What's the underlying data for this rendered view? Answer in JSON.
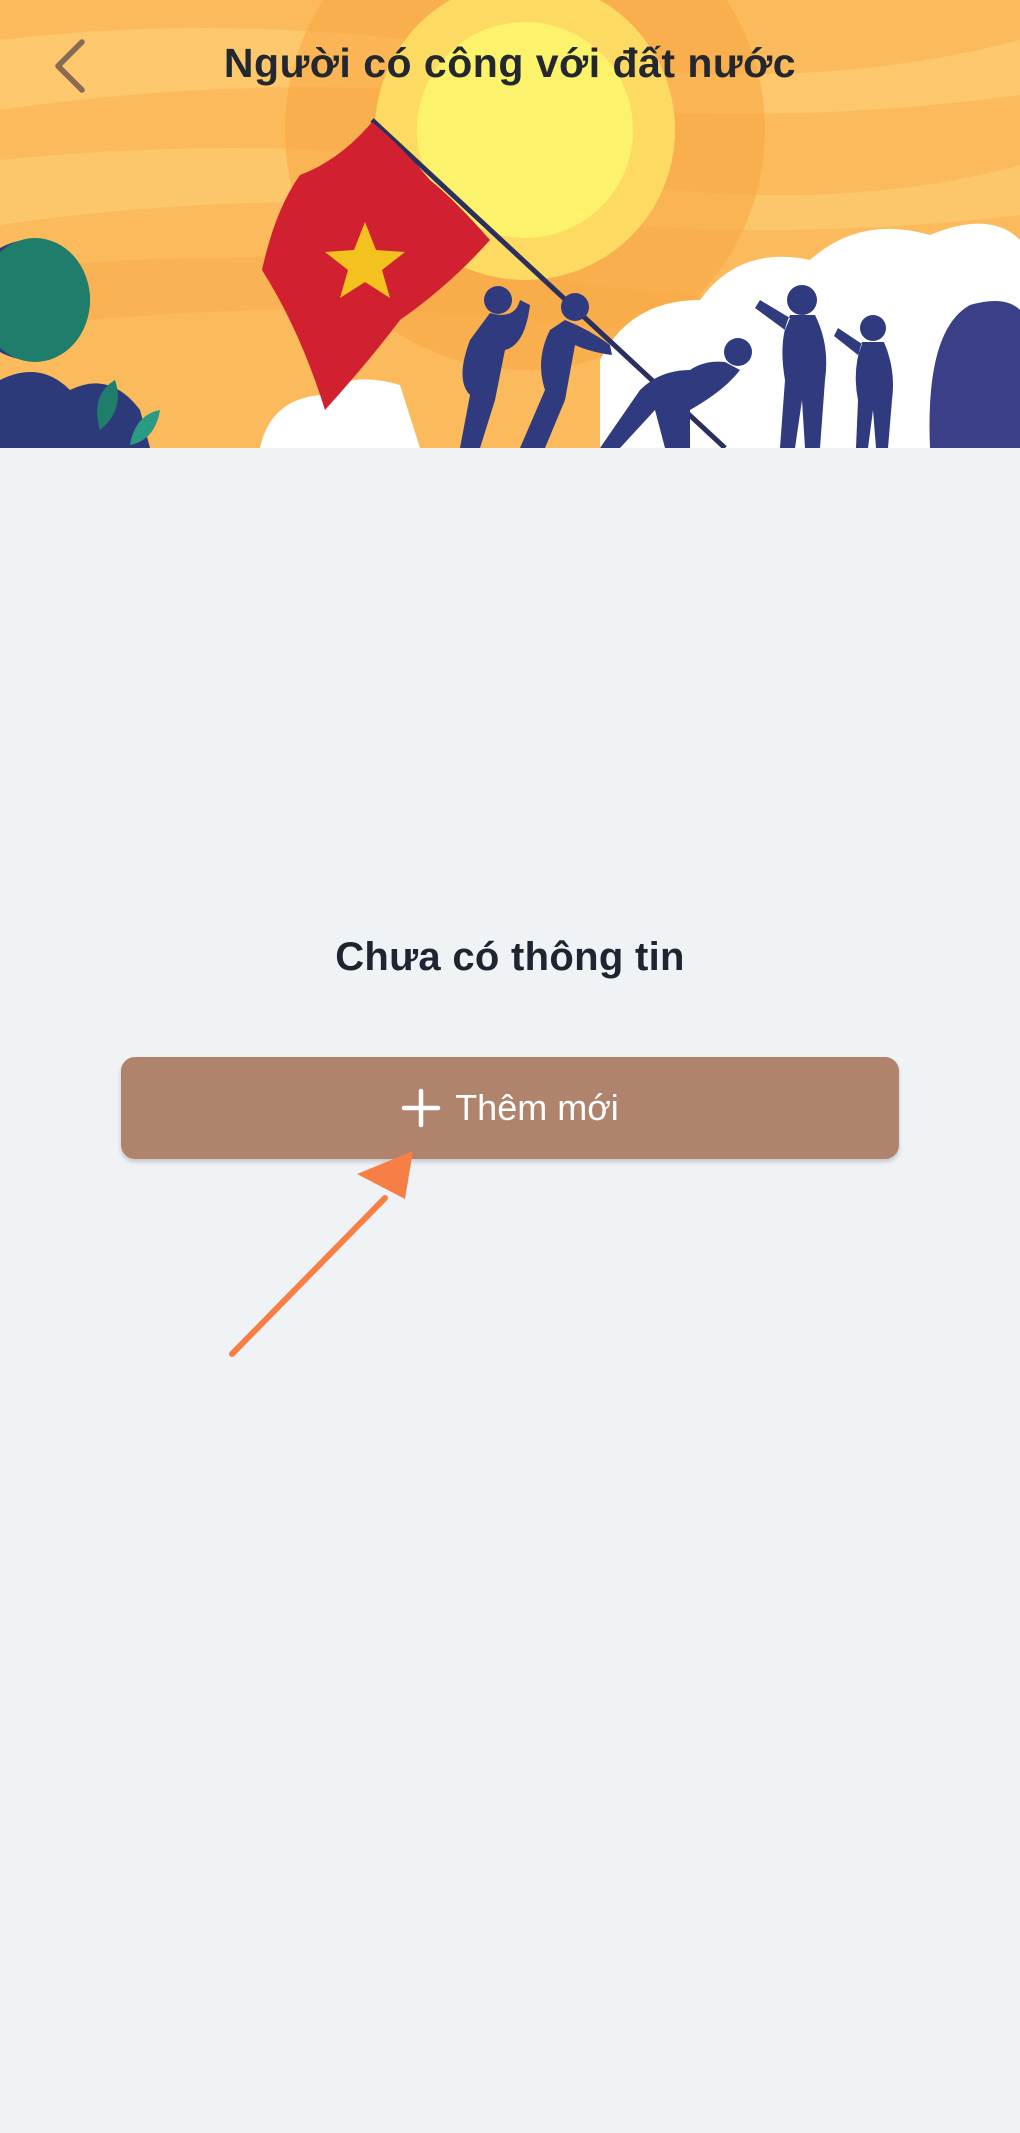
{
  "header": {
    "title": "Người có công với đất nước",
    "back_icon": "chevron-left-icon",
    "banner_icon": "soldiers-flag-illustration"
  },
  "main": {
    "empty_message": "Chưa có thông tin",
    "add_button": {
      "label": "Thêm mới",
      "icon": "plus-icon"
    }
  },
  "annotation": {
    "icon": "arrow-pointer-icon"
  },
  "colors": {
    "background": "#f0f3f6",
    "button": "#b0836c",
    "arrow": "#f77e45",
    "title_text": "#23272f",
    "back_icon": "#8a6a52",
    "flag_red": "#d12131",
    "flag_star": "#f4c21e",
    "silhouette": "#303a7e",
    "sky": "#fbbb5d",
    "sun": "#fdf26b"
  }
}
